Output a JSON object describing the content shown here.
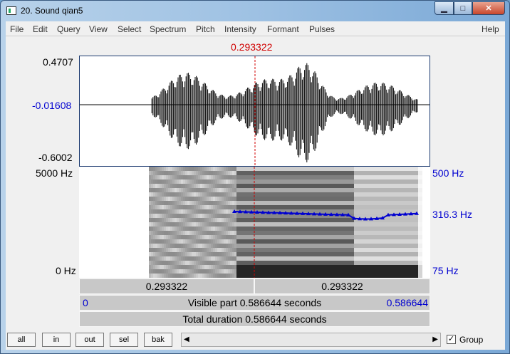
{
  "window": {
    "title": "20. Sound qian5"
  },
  "menu": [
    "File",
    "Edit",
    "Query",
    "View",
    "Select",
    "Spectrum",
    "Pitch",
    "Intensity",
    "Formant",
    "Pulses",
    "Help"
  ],
  "cursor": {
    "time": "0.293322"
  },
  "waveform": {
    "max": "0.4707",
    "mid": "-0.01608",
    "min": "-0.6002"
  },
  "spectrogram": {
    "top_freq": "5000 Hz",
    "bottom_freq": "0 Hz"
  },
  "pitch": {
    "top": "500 Hz",
    "current": "316.3 Hz",
    "bottom": "75 Hz"
  },
  "timebar": {
    "left_segment": "0.293322",
    "right_segment": "0.293322",
    "visible_start": "0",
    "visible_label": "Visible part 0.586644 seconds",
    "visible_end": "0.586644",
    "total_label": "Total duration 0.586644 seconds"
  },
  "buttons": {
    "all": "all",
    "in": "in",
    "out": "out",
    "sel": "sel",
    "bak": "bak"
  },
  "group": {
    "label": "Group",
    "checked": "✓"
  },
  "colors": {
    "cursor": "#d00000",
    "pitch_track": "#0000d0",
    "axis_blue": "#0000d0"
  }
}
